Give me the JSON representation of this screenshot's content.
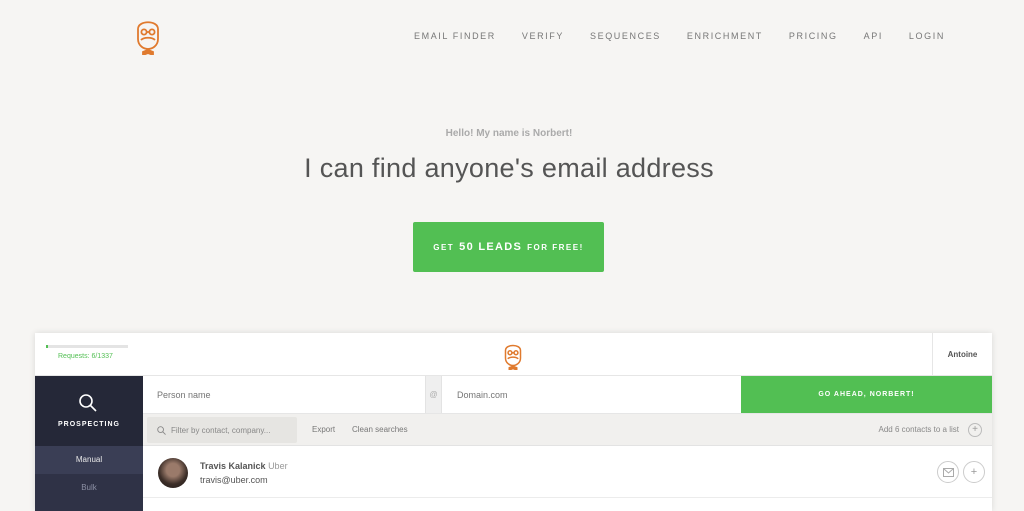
{
  "nav": {
    "items": [
      "EMAIL FINDER",
      "VERIFY",
      "SEQUENCES",
      "ENRICHMENT",
      "PRICING",
      "API",
      "LOGIN"
    ]
  },
  "hero": {
    "subtitle": "Hello! My name is Norbert!",
    "title": "I can find anyone's email address",
    "cta_small_1": "GET",
    "cta_big": "50 LEADS",
    "cta_small_2": "FOR FREE!"
  },
  "app": {
    "requests": "Requests: 6/1337",
    "requests_fraction": 0.0045,
    "user": "Antoine",
    "sidebar": {
      "title": "PROSPECTING",
      "items": [
        "Manual",
        "Bulk"
      ]
    },
    "search": {
      "person_placeholder": "Person name",
      "at": "@",
      "domain_placeholder": "Domain.com",
      "go_label": "GO AHEAD, NORBERT!"
    },
    "filter": {
      "placeholder": "Filter by contact, company...",
      "export": "Export",
      "clean": "Clean searches",
      "add_list": "Add 6 contacts to a list"
    },
    "contacts": [
      {
        "name": "Travis Kalanick",
        "company": "Uber",
        "email": "travis@uber.com"
      }
    ]
  },
  "colors": {
    "accent": "#52bf53",
    "sidebar": "#2f3246",
    "logo": "#e07a2e"
  }
}
